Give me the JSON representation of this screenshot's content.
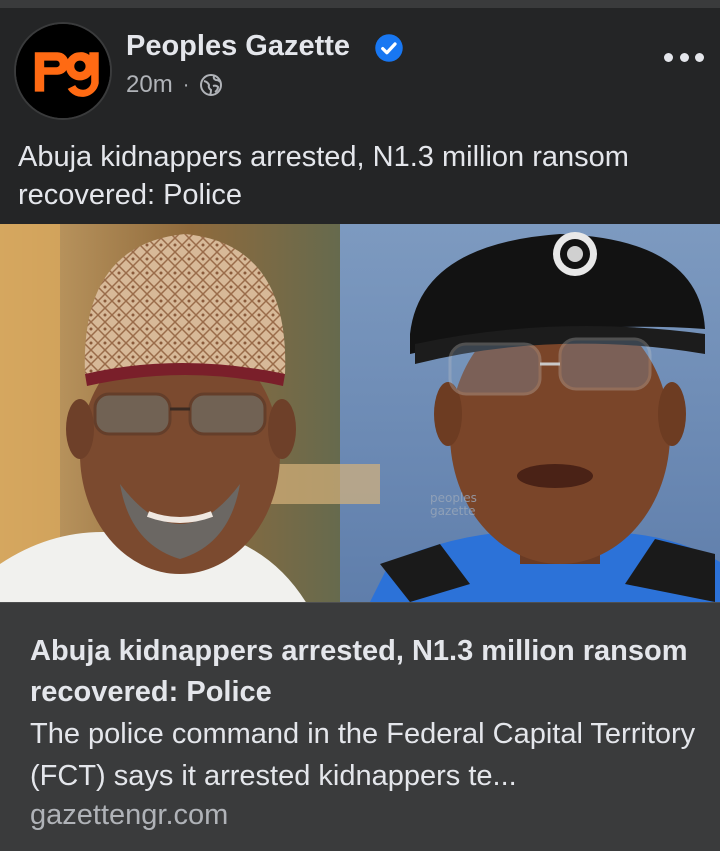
{
  "post": {
    "author": "Peoples Gazette",
    "time": "20m",
    "separator": "·",
    "privacy_icon": "globe-icon",
    "verified_icon": "verified-badge-icon",
    "text": "Abuja kidnappers arrested, N1.3 million ransom recovered: Police"
  },
  "image": {
    "watermark_line1": "peoples",
    "watermark_line2": "gazette"
  },
  "link_preview": {
    "title": "Abuja kidnappers arrested, N1.3 million ransom recovered: Police",
    "description": "The police command in the Federal Capital Territory (FCT) says it arrested kidnappers te...",
    "domain": "gazettengr.com"
  },
  "colors": {
    "background": "#242526",
    "card": "#3a3b3c",
    "text_primary": "#e4e6eb",
    "text_secondary": "#b0b3b8",
    "verified_blue": "#1877f2",
    "brand_orange": "#ff6a13"
  }
}
